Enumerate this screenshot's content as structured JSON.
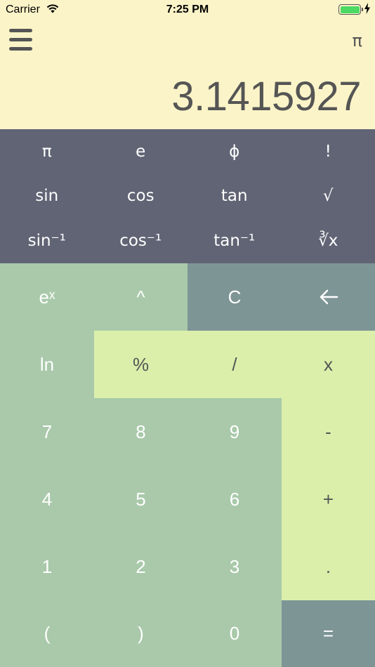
{
  "status_bar": {
    "carrier": "Carrier",
    "time": "7:25 PM"
  },
  "header": {
    "mode_symbol": "π",
    "display_value": "3.1415927"
  },
  "scientific_keys": [
    "π",
    "e",
    "ϕ",
    "!",
    "sin",
    "cos",
    "tan",
    "√",
    "sin⁻¹",
    "cos⁻¹",
    "tan⁻¹",
    "∛x"
  ],
  "keys": {
    "exp": "eˣ",
    "power": "^",
    "clear": "C",
    "backspace": "←",
    "ln": "ln",
    "percent": "%",
    "divide": "/",
    "multiply": "x",
    "seven": "7",
    "eight": "8",
    "nine": "9",
    "minus": "-",
    "four": "4",
    "five": "5",
    "six": "6",
    "plus": "+",
    "one": "1",
    "two": "2",
    "three": "3",
    "dot": ".",
    "lparen": "(",
    "rparen": ")",
    "zero": "0",
    "equals": "="
  },
  "colors": {
    "header_bg": "#fbf4c8",
    "scientific_bg": "#606474",
    "green": "#a9c9aa",
    "lime": "#dbefab",
    "slate": "#7e9596"
  }
}
